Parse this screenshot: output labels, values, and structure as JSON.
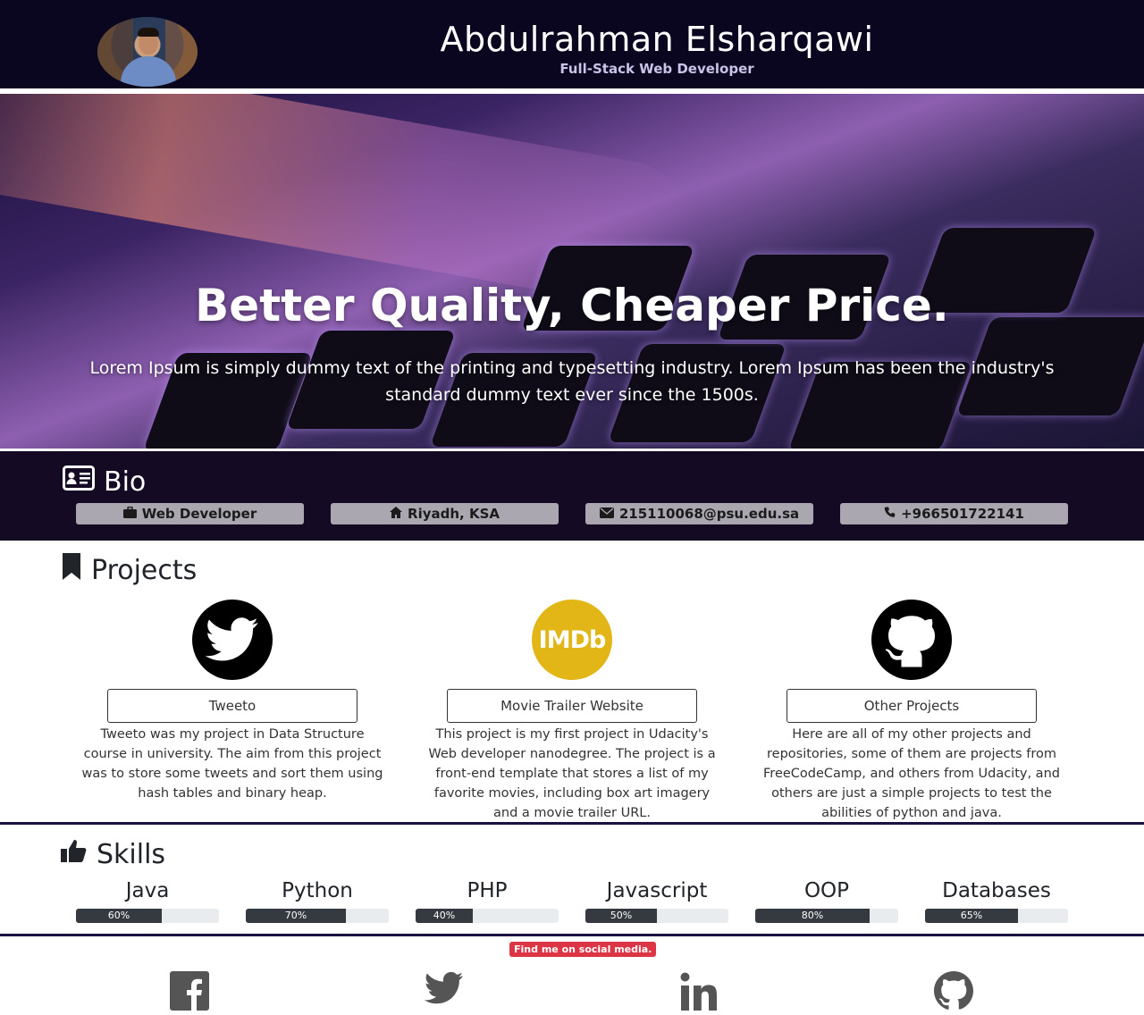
{
  "header": {
    "name": "Abdulrahman Elsharqawi",
    "role": "Full-Stack Web Developer"
  },
  "hero": {
    "title": "Better Quality, Cheaper Price.",
    "text": "Lorem Ipsum is simply dummy text of the printing and typesetting industry. Lorem Ipsum has been the industry's standard dummy text ever since the 1500s."
  },
  "bio": {
    "title": "Bio",
    "items": [
      {
        "icon": "briefcase-icon",
        "label": "Web Developer"
      },
      {
        "icon": "home-icon",
        "label": "Riyadh, KSA"
      },
      {
        "icon": "envelope-icon",
        "label": "215110068@psu.edu.sa"
      },
      {
        "icon": "phone-icon",
        "label": "+966501722141"
      }
    ]
  },
  "projects": {
    "title": "Projects",
    "items": [
      {
        "icon": "twitter-logo-icon",
        "button": "Tweeto",
        "desc": "Tweeto was my project in Data Structure course in university. The aim from this project was to store some tweets and sort them using hash tables and binary heap."
      },
      {
        "icon": "imdb-logo-icon",
        "logo_text": "IMDb",
        "button": "Movie Trailer Website",
        "desc": "This project is my first project in Udacity's Web developer nanodegree. The project is a front-end template that stores a list of my favorite movies, including box art imagery and a movie trailer URL."
      },
      {
        "icon": "github-logo-icon",
        "button": "Other Projects",
        "desc": "Here are all of my other projects and repositories, some of them are projects from FreeCodeCamp, and others from Udacity, and others are just a simple projects to test the abilities of python and java."
      }
    ]
  },
  "skills": {
    "title": "Skills",
    "items": [
      {
        "name": "Java",
        "percent": 60,
        "label": "60%"
      },
      {
        "name": "Python",
        "percent": 70,
        "label": "70%"
      },
      {
        "name": "PHP",
        "percent": 40,
        "label": "40%"
      },
      {
        "name": "Javascript",
        "percent": 50,
        "label": "50%"
      },
      {
        "name": "OOP",
        "percent": 80,
        "label": "80%"
      },
      {
        "name": "Databases",
        "percent": 65,
        "label": "65%"
      }
    ]
  },
  "social": {
    "badge": "Find me on social media.",
    "icons": [
      "facebook-icon",
      "twitter-icon",
      "linkedin-icon",
      "github-icon"
    ]
  },
  "colors": {
    "header_bg": "#0b0620",
    "bio_bg": "#140a24",
    "badge": "#dc3545",
    "progress_fill": "#343a40"
  }
}
